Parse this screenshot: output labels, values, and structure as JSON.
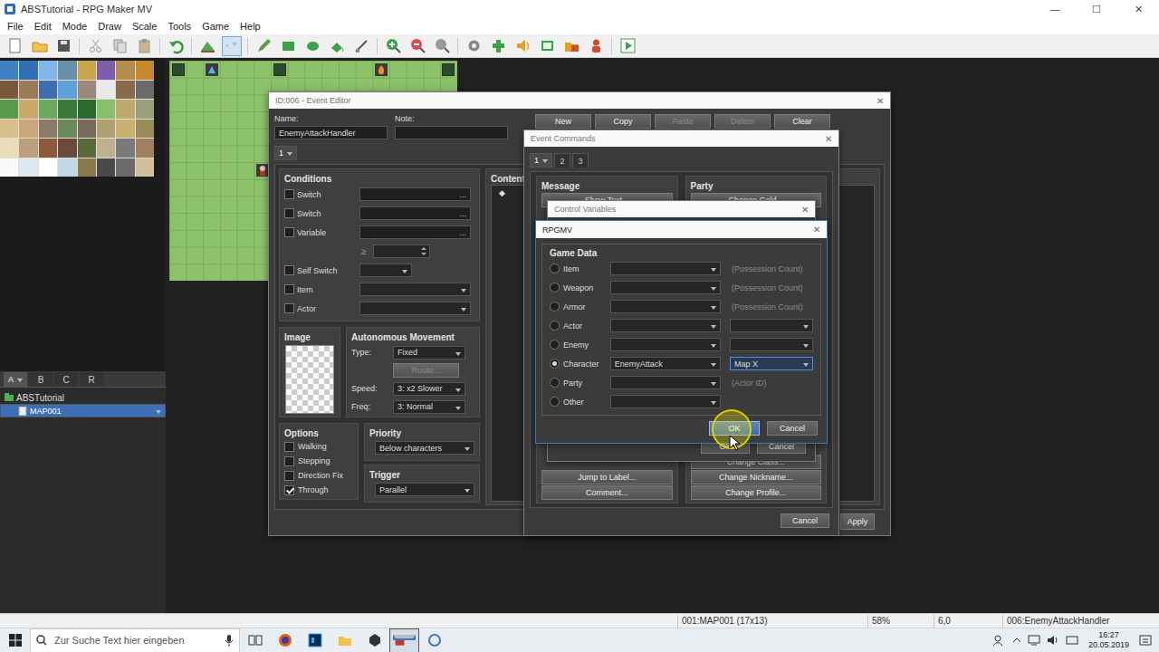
{
  "app": {
    "title": "ABSTutorial - RPG Maker MV",
    "controls": [
      "—",
      "☐",
      "✕"
    ]
  },
  "menu": [
    "File",
    "Edit",
    "Mode",
    "Draw",
    "Scale",
    "Tools",
    "Game",
    "Help"
  ],
  "toolbar": {
    "modes": [
      {
        "selected": false
      },
      {
        "selected": true
      }
    ]
  },
  "layer_tabs": [
    {
      "label": "A",
      "selected": true
    },
    {
      "label": "B",
      "selected": false
    },
    {
      "label": "C",
      "selected": false
    },
    {
      "label": "R",
      "selected": false
    }
  ],
  "tree": [
    {
      "label": "ABSTutorial",
      "kind": "project",
      "selected": false
    },
    {
      "label": "MAP001",
      "kind": "map",
      "selected": true
    }
  ],
  "event_editor": {
    "title": "ID:006 - Event Editor",
    "close": "✕",
    "name_label": "Name:",
    "name": "EnemyAttackHandler",
    "note_label": "Note:",
    "note": "",
    "page_buttons": [
      {
        "label": "New",
        "disabled": false
      },
      {
        "label": "Copy",
        "disabled": false
      },
      {
        "label": "Paste",
        "disabled": true
      },
      {
        "label": "Delete",
        "disabled": true
      },
      {
        "label": "Clear",
        "disabled": false
      }
    ],
    "tabs": [
      {
        "label": "1",
        "selected": true
      }
    ],
    "conditions": {
      "title": "Conditions",
      "rows": [
        {
          "kind": "picker",
          "label": "Switch",
          "checked": false,
          "value": "",
          "button": "..."
        },
        {
          "kind": "picker",
          "label": "Switch",
          "checked": false,
          "value": "",
          "button": "..."
        },
        {
          "kind": "picker",
          "label": "Variable",
          "checked": false,
          "value": "",
          "button": "..."
        },
        {
          "kind": "compare",
          "operator": "≥",
          "value": ""
        },
        {
          "kind": "select-short",
          "label": "Self Switch",
          "checked": false,
          "value": ""
        },
        {
          "kind": "select",
          "label": "Item",
          "checked": false,
          "value": ""
        },
        {
          "kind": "select",
          "label": "Actor",
          "checked": false,
          "value": ""
        }
      ]
    },
    "image": {
      "title": "Image"
    },
    "movement": {
      "title": "Autonomous Movement",
      "type_label": "Type:",
      "type": "Fixed",
      "route": {
        "label": "Route...",
        "disabled": true
      },
      "speed_label": "Speed:",
      "speed": "3: x2 Slower",
      "freq_label": "Freq:",
      "freq": "3: Normal"
    },
    "options": {
      "title": "Options",
      "items": [
        {
          "label": "Walking",
          "checked": false
        },
        {
          "label": "Stepping",
          "checked": false
        },
        {
          "label": "Direction Fix",
          "checked": false
        },
        {
          "label": "Through",
          "checked": true
        }
      ]
    },
    "priority": {
      "title": "Priority",
      "value": "Below characters"
    },
    "trigger": {
      "title": "Trigger",
      "value": "Parallel"
    },
    "contents": {
      "title": "Contents",
      "lines": [
        "◆"
      ]
    },
    "buttons": [
      "Apply"
    ]
  },
  "event_commands": {
    "title": "Event Commands",
    "close": "✕",
    "tabs": [
      {
        "label": "1",
        "selected": true
      },
      {
        "label": "2",
        "selected": false
      },
      {
        "label": "3",
        "selected": false
      }
    ],
    "columns": [
      {
        "title": "Message",
        "top": [
          "Show Text..."
        ],
        "bottom": [
          "Jump to Label...",
          "Comment..."
        ]
      },
      {
        "title": "Party",
        "top": [
          "Change Gold..."
        ],
        "bottom": [
          "Change Class...",
          "Change Nickname...",
          "Change Profile..."
        ]
      }
    ],
    "buttons": [
      "Cancel"
    ]
  },
  "control_variables": {
    "title": "Control Variables",
    "close": "✕",
    "buttons": [
      "OK",
      "Cancel"
    ]
  },
  "rpgmv": {
    "title": "RPGMV",
    "close": "✕",
    "group": "Game Data",
    "rows": [
      {
        "label": "Item",
        "selected": false,
        "value": "",
        "kind": "note",
        "extra": "(Possession Count)",
        "focused": false
      },
      {
        "label": "Weapon",
        "selected": false,
        "value": "",
        "kind": "note",
        "extra": "(Possession Count)",
        "focused": false
      },
      {
        "label": "Armor",
        "selected": false,
        "value": "",
        "kind": "note",
        "extra": "(Possession Count)",
        "focused": false
      },
      {
        "label": "Actor",
        "selected": false,
        "value": "",
        "kind": "select",
        "extra": "",
        "focused": false
      },
      {
        "label": "Enemy",
        "selected": false,
        "value": "",
        "kind": "select",
        "extra": "",
        "focused": false
      },
      {
        "label": "Character",
        "selected": true,
        "value": "EnemyAttack",
        "kind": "select",
        "extra": "Map X",
        "focused": true
      },
      {
        "label": "Party",
        "selected": false,
        "value": "",
        "kind": "note",
        "extra": "(Actor ID)",
        "focused": false
      },
      {
        "label": "Other",
        "selected": false,
        "value": "",
        "kind": "none",
        "extra": "",
        "focused": false
      }
    ],
    "buttons": [
      {
        "label": "OK",
        "focused": true
      },
      {
        "label": "Cancel",
        "focused": false
      }
    ]
  },
  "status_bar": [
    "001:MAP001 (17x13)",
    "58%",
    "6,0",
    "006:EnemyAttackHandler"
  ],
  "taskbar": {
    "search": {
      "placeholder": "Zur Suche Text hier eingeben"
    },
    "apps": [
      {
        "selected": false
      },
      {
        "selected": false
      },
      {
        "selected": false
      },
      {
        "selected": false
      },
      {
        "selected": false
      },
      {
        "selected": true
      },
      {
        "selected": false
      }
    ],
    "time": "16:27",
    "date": "20.05.2019"
  }
}
